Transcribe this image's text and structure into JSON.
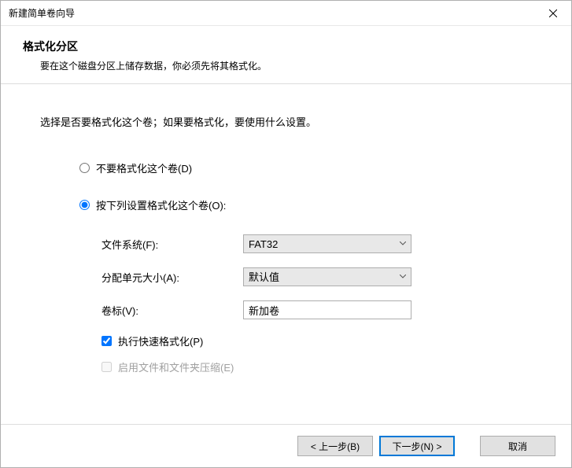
{
  "window": {
    "title": "新建简单卷向导"
  },
  "header": {
    "title": "格式化分区",
    "subtitle": "要在这个磁盘分区上储存数据，你必须先将其格式化。"
  },
  "instruction": "选择是否要格式化这个卷；如果要格式化，要使用什么设置。",
  "radios": {
    "noFormat": "不要格式化这个卷(D)",
    "formatWith": "按下列设置格式化这个卷(O):"
  },
  "fields": {
    "fileSystemLabel": "文件系统(F):",
    "fileSystemValue": "FAT32",
    "allocLabel": "分配单元大小(A):",
    "allocValue": "默认值",
    "volumeLabelLabel": "卷标(V):",
    "volumeLabelValue": "新加卷"
  },
  "checks": {
    "quickFormat": "执行快速格式化(P)",
    "compression": "启用文件和文件夹压缩(E)"
  },
  "footer": {
    "back": "< 上一步(B)",
    "next": "下一步(N) >",
    "cancel": "取消"
  }
}
